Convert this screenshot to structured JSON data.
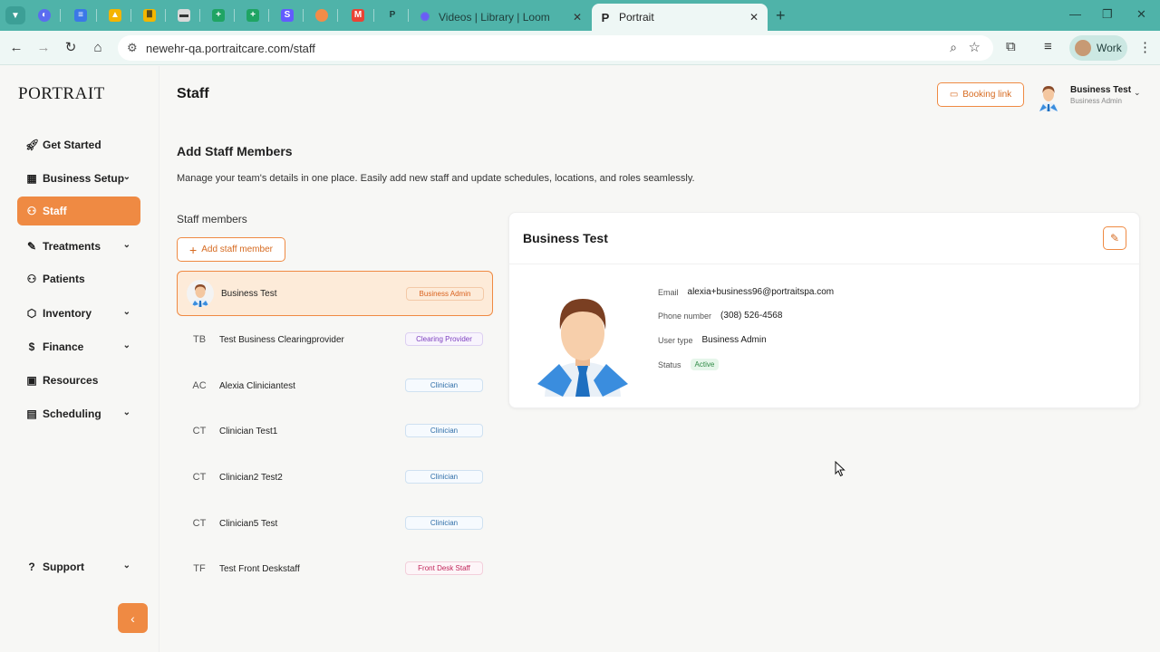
{
  "browser": {
    "tabs": [
      {
        "title": "Videos | Library | Loom"
      },
      {
        "title": "Portrait"
      }
    ],
    "url": "newehr-qa.portraitcare.com/staff",
    "profile_label": "Work"
  },
  "app": {
    "logo": "PORTRAIT",
    "sidebar": {
      "items": [
        {
          "label": "Get Started"
        },
        {
          "label": "Business Setup"
        },
        {
          "label": "Staff"
        },
        {
          "label": "Treatments"
        },
        {
          "label": "Patients"
        },
        {
          "label": "Inventory"
        },
        {
          "label": "Finance"
        },
        {
          "label": "Resources"
        },
        {
          "label": "Scheduling"
        }
      ],
      "support": "Support"
    },
    "header": {
      "title": "Staff",
      "booking_link": "Booking link",
      "user_name": "Business Test",
      "user_role": "Business Admin"
    },
    "main": {
      "section_title": "Add Staff Members",
      "section_desc": "Manage your team's details in one place. Easily add new staff and update schedules, locations, and roles seamlessly.",
      "staff_heading": "Staff members",
      "add_button": "Add staff member",
      "staff": [
        {
          "initials": "",
          "name": "Business Test",
          "role": "Business Admin"
        },
        {
          "initials": "TB",
          "name": "Test Business Clearingprovider",
          "role": "Clearing Provider"
        },
        {
          "initials": "AC",
          "name": "Alexia Cliniciantest",
          "role": "Clinician"
        },
        {
          "initials": "CT",
          "name": "Clinician Test1",
          "role": "Clinician"
        },
        {
          "initials": "CT",
          "name": "Clinician2 Test2",
          "role": "Clinician"
        },
        {
          "initials": "CT",
          "name": "Clinician5 Test",
          "role": "Clinician"
        },
        {
          "initials": "TF",
          "name": "Test Front Deskstaff",
          "role": "Front Desk Staff"
        }
      ],
      "detail": {
        "name": "Business Test",
        "email_label": "Email",
        "email": "alexia+business96@portraitspa.com",
        "phone_label": "Phone number",
        "phone": "(308) 526-4568",
        "type_label": "User type",
        "type": "Business Admin",
        "status_label": "Status",
        "status": "Active"
      }
    }
  },
  "colors": {
    "accent": "#ef8a43",
    "browser_frame": "#4fb3a9",
    "active_status": "#2e8a45"
  }
}
